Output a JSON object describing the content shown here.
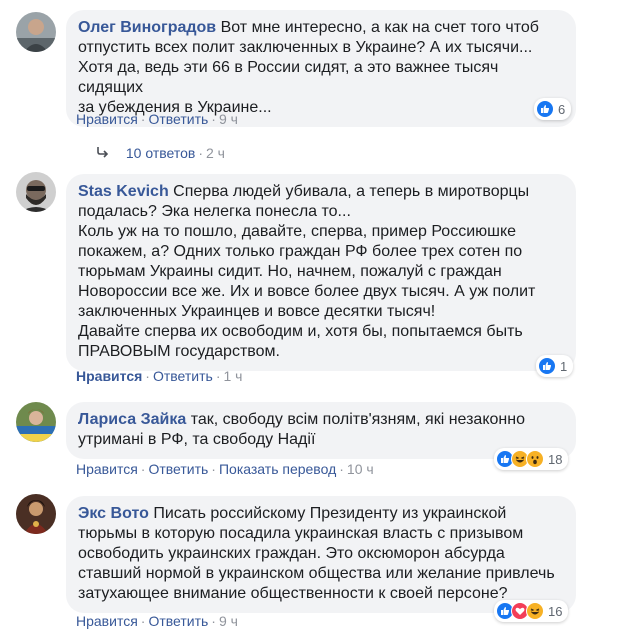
{
  "comments": [
    {
      "author": "Олег Виноградов",
      "text": "Вот мне интересно, а как на счет того чтоб\nотпустить всех полит заключенных в Украине? А их тысячи...\nХотя да, ведь эти 66 в России сидят, а это важнее тысяч сидящих\nза убеждения в Украине...",
      "like": "Нравится",
      "reply": "Ответить",
      "time": "9 ч",
      "reaction_count": "6",
      "reaction_icons": [
        "like-icon"
      ]
    },
    {
      "author": "Stas Kevich",
      "text": "Сперва людей убивала, а теперь в миротворцы\nподалась? Эка нелегка понесла то...\nКоль уж на то пошло, давайте, сперва, пример Россиюшке\nпокажем, а? Одних только граждан РФ более трех сотен по\nтюрьмам Украины сидит. Но, начнем, пожалуй с граждан\nНовороссии все же. Их и вовсе более двух тысяч. А уж полит\nзаключенных Украинцев и вовсе десятки тысяч!\nДавайте сперва их освободим и, хотя бы, попытаемся быть\nПРАВОВЫМ государством.",
      "like": "Нравится",
      "reply": "Ответить",
      "time": "1 ч",
      "reaction_count": "1",
      "reaction_icons": [
        "like-icon"
      ]
    },
    {
      "author": "Лариса Зайка",
      "text": "так, свободу всім політв'язням, які незаконно\nутримані в РФ, та свободу Надії",
      "like": "Нравится",
      "reply": "Ответить",
      "translate": "Показать перевод",
      "time": "10 ч",
      "reaction_count": "18",
      "reaction_icons": [
        "like-icon",
        "haha-icon",
        "wow-icon"
      ]
    },
    {
      "author": "Экс Вото",
      "text": "Писать российскому Президенту из украинской\nтюрьмы в которую посадила украинская власть с призывом\nосвободить украинских граждан. Это оксюморон абсурда\nставший нормой в украинском общества или желание привлечь\nзатухающее внимание общественности к своей персоне?",
      "like": "Нравится",
      "reply": "Ответить",
      "time": "9 ч",
      "reaction_count": "16",
      "reaction_icons": [
        "like-icon",
        "love-icon",
        "haha-icon"
      ]
    }
  ],
  "replies_link": {
    "label": "10 ответов",
    "time": "2 ч"
  },
  "colors": {
    "link": "#385898",
    "bubble": "#f2f3f5",
    "like": "#1877f2",
    "love": "#f33e58",
    "haha": "#f7b125"
  }
}
